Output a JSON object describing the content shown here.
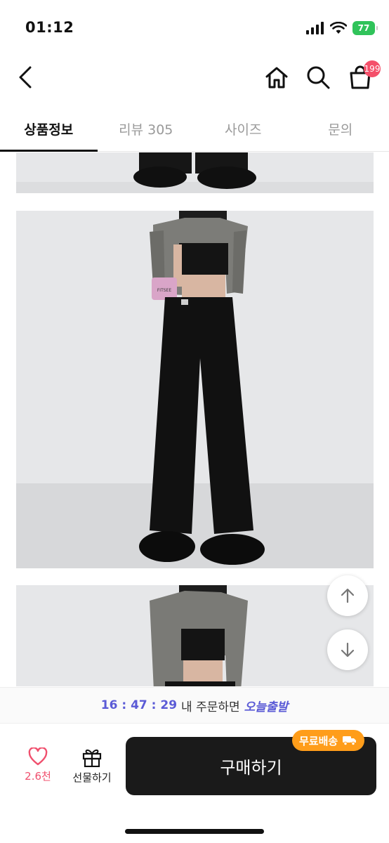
{
  "status_bar": {
    "time": "01:12",
    "battery": "77"
  },
  "header": {
    "cart_count": "199"
  },
  "tabs": [
    {
      "label": "상품정보"
    },
    {
      "label": "리뷰 305"
    },
    {
      "label": "사이즈"
    },
    {
      "label": "문의"
    }
  ],
  "product": {
    "pouch_label": "FITSEE"
  },
  "timer_banner": {
    "time": "16 : 47 : 29",
    "text": "내 주문하면",
    "highlight": "오늘출발"
  },
  "bottom_bar": {
    "like_count": "2.6천",
    "gift_label": "선물하기",
    "buy_label": "구매하기",
    "shipping_badge": "무료배송"
  },
  "colors": {
    "accent": "#5b5bd6",
    "like": "#f0506e",
    "badge": "#ff9d1a",
    "cart_badge": "#f4506a"
  }
}
